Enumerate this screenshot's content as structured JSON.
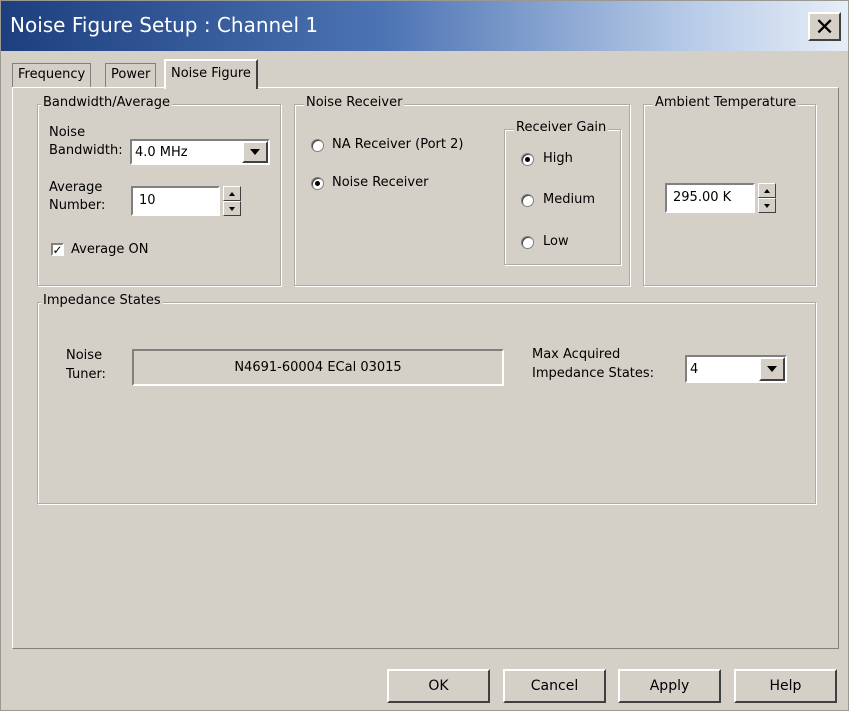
{
  "window": {
    "title": "Noise Figure Setup : Channel 1",
    "close_label": "✕"
  },
  "tabs": [
    {
      "label": "Frequency",
      "active": false
    },
    {
      "label": "Power",
      "active": false
    },
    {
      "label": "Noise Figure",
      "active": true
    }
  ],
  "bandwidth_average": {
    "legend": "Bandwidth/Average",
    "noise_bandwidth_label_line1": "Noise",
    "noise_bandwidth_label_line2": "Bandwidth:",
    "noise_bandwidth_value": "4.0 MHz",
    "average_number_label_line1": "Average",
    "average_number_label_line2": "Number:",
    "average_number_value": "10",
    "average_on_label": "Average ON",
    "average_on_checked": true
  },
  "noise_receiver": {
    "legend": "Noise Receiver",
    "options": [
      {
        "label": "NA Receiver (Port 2)",
        "checked": false
      },
      {
        "label": "Noise Receiver",
        "checked": true
      }
    ]
  },
  "receiver_gain": {
    "legend": "Receiver Gain",
    "options": [
      {
        "label": "High",
        "checked": true
      },
      {
        "label": "Medium",
        "checked": false
      },
      {
        "label": "Low",
        "checked": false
      }
    ]
  },
  "ambient_temperature": {
    "legend": "Ambient Temperature",
    "value": "295.00 K"
  },
  "impedance_states": {
    "legend": "Impedance States",
    "noise_tuner_label_line1": "Noise",
    "noise_tuner_label_line2": "Tuner:",
    "noise_tuner_value": "N4691-60004 ECal 03015",
    "max_states_label_line1": "Max Acquired",
    "max_states_label_line2": "Impedance States:",
    "max_states_value": "4"
  },
  "buttons": {
    "ok": "OK",
    "cancel": "Cancel",
    "apply": "Apply",
    "help": "Help"
  },
  "colors": {
    "dialog_face": "#d4d0c8",
    "titlebar_dark": "#1d3f7e",
    "titlebar_light": "#e6eef8"
  }
}
